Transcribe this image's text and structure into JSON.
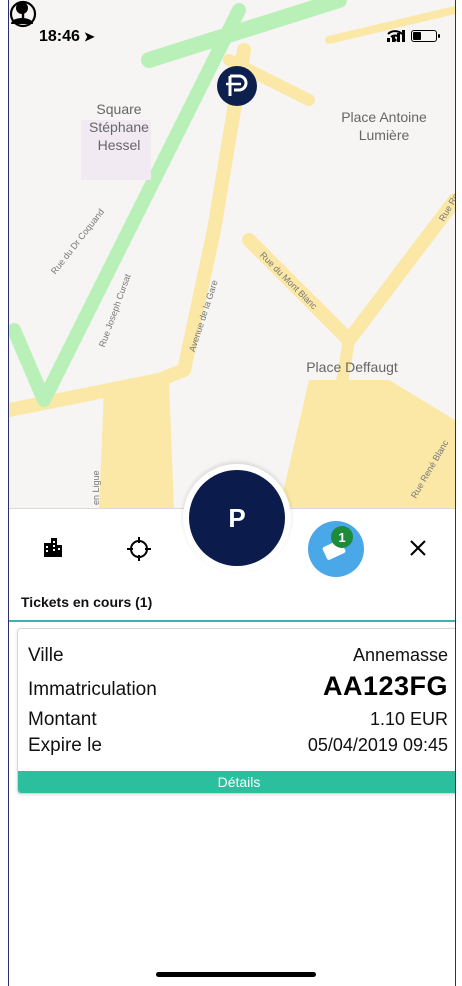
{
  "status_bar": {
    "time": "18:46",
    "location_arrow": "location-arrow-icon",
    "battery_level": 0.4
  },
  "map": {
    "labels": {
      "square": "Square\nStéphane\nHessel",
      "place_antoine": "Place Antoine\nLumière",
      "place_deffaugt": "Place Deffaugt"
    },
    "streets": {
      "coquand": "Rue du Dr Coquand",
      "cursat": "Rue Joseph Cursat",
      "gare": "Avenue de la Gare",
      "mont_blanc": "Rue du Mont Blanc",
      "rene_blanc": "Rue René Blanc",
      "ligue": "en Ligue",
      "re": "Rue Re"
    }
  },
  "toolbar": {
    "city_icon": "city-icon",
    "locate_icon": "crosshair-icon",
    "parking_label": "P",
    "tickets_badge": "1",
    "close_icon": "close-icon"
  },
  "tickets": {
    "section_title": "Tickets en cours (1)",
    "card": {
      "ville_label": "Ville",
      "ville_value": "Annemasse",
      "immat_label": "Immatriculation",
      "immat_value": "AA123FG",
      "montant_label": "Montant",
      "montant_value": "1.10 EUR",
      "expire_label": "Expire le",
      "expire_value": "05/04/2019 09:45",
      "details_label": "Détails"
    }
  },
  "colors": {
    "navy": "#0b1b4b",
    "teal": "#2bbf9e",
    "blue": "#4aa7e8",
    "green_badge": "#1c8c3a"
  }
}
